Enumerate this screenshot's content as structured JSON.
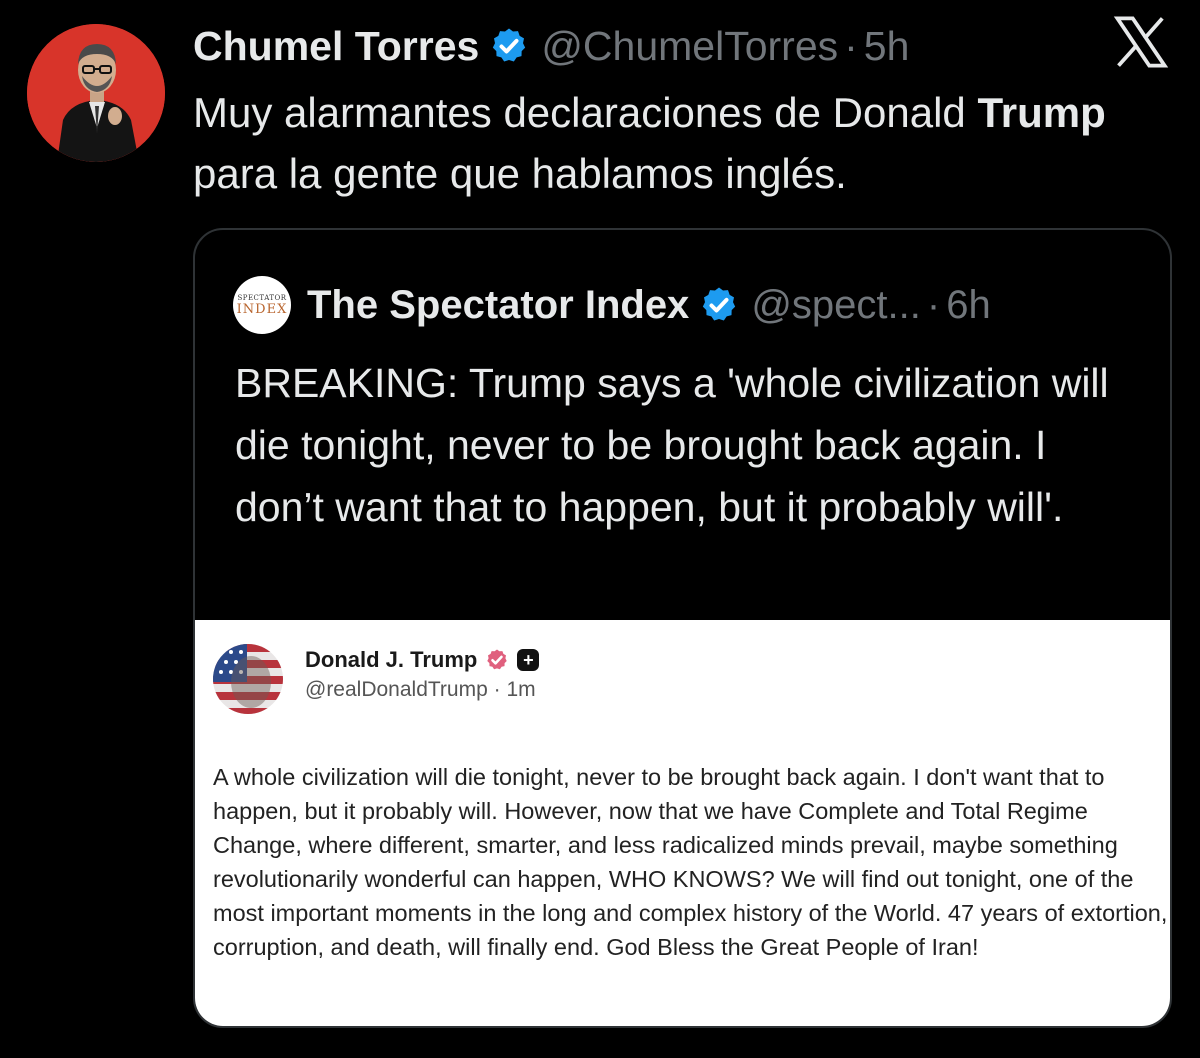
{
  "tweet": {
    "display_name": "Chumel Torres",
    "handle": "@ChumelTorres",
    "time": "5h",
    "text_before": "Muy alarmantes declaraciones de Donald ",
    "text_bold": "Trump",
    "text_after": " para la gente que hablamos inglés.",
    "avatar_bg": "#d8342a",
    "icons": [
      "verified-badge-icon",
      "x-logo-icon"
    ]
  },
  "quote": {
    "avatar_top": "SPECTATOR",
    "avatar_bottom": "INDEX",
    "display_name": "The Spectator Index",
    "handle": "@spect...",
    "time": "6h",
    "text": "BREAKING: Trump says a 'whole civilization will die tonight, never to be brought back again. I don’t want that to happen, but it probably will'."
  },
  "truth_post": {
    "display_name": "Donald J. Trump",
    "plus": "+",
    "handle": "@realDonaldTrump",
    "time": "1m",
    "text": "A whole civilization will die tonight, never to be brought back again. I don't want that to happen, but it probably will. However, now that we have Complete and Total Regime Change, where different, smarter, and less radicalized minds prevail, maybe something revolutionarily wonderful can happen, WHO KNOWS? We will find out tonight, one of the most important moments in the long and complex history of the World. 47 years of extortion, corruption, and death, will finally end. God Bless the Great People of Iran!"
  },
  "colors": {
    "background": "#000000",
    "text": "#e7e9ea",
    "muted": "#71767b",
    "verified_blue": "#1d9bf0",
    "truth_badge": "#e0607e"
  }
}
